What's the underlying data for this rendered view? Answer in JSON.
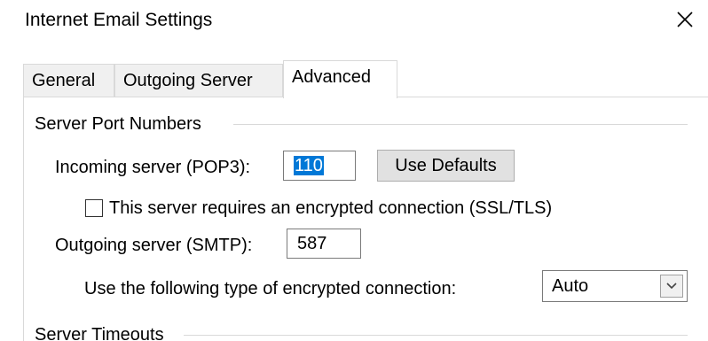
{
  "window": {
    "title": "Internet Email Settings"
  },
  "tabs": [
    {
      "label": "General"
    },
    {
      "label": "Outgoing Server"
    },
    {
      "label": "Advanced"
    }
  ],
  "active_tab": "Advanced",
  "server_port_numbers": {
    "group_title": "Server Port Numbers",
    "incoming_label": "Incoming server (POP3):",
    "incoming_value": "110",
    "use_defaults_label": "Use Defaults",
    "ssl_checkbox_label": "This server requires an encrypted connection (SSL/TLS)",
    "ssl_checked": false,
    "outgoing_label": "Outgoing server (SMTP):",
    "outgoing_value": "587",
    "encryption_label": "Use the following type of encrypted connection:",
    "encryption_value": "Auto"
  },
  "server_timeouts": {
    "group_title": "Server Timeouts"
  },
  "icons": {
    "close": "close-icon",
    "dropdown": "chevron-down-icon"
  }
}
